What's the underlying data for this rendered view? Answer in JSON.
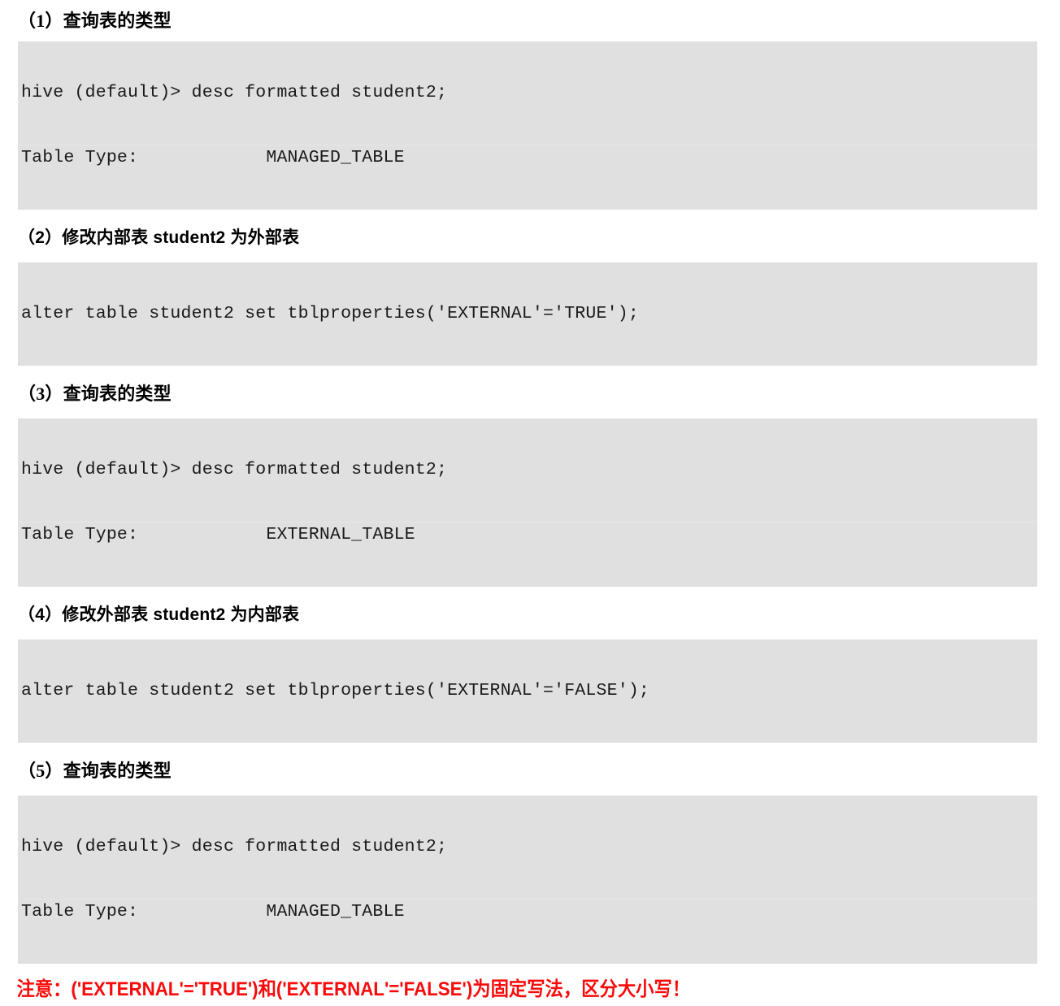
{
  "document": {
    "sections": [
      {
        "id": "s1",
        "heading": "（1）查询表的类型",
        "heading_style": "serif",
        "code_lines": [
          "hive (default)> desc formatted student2;",
          "Table Type:            MANAGED_TABLE"
        ]
      },
      {
        "id": "s2",
        "heading": "（2）修改内部表 student2 为外部表",
        "heading_style": "sans",
        "code_lines": [
          "alter table student2 set tblproperties('EXTERNAL'='TRUE');"
        ]
      },
      {
        "id": "s3",
        "heading": "（3）查询表的类型",
        "heading_style": "serif",
        "code_lines": [
          "hive (default)> desc formatted student2;",
          "Table Type:            EXTERNAL_TABLE"
        ]
      },
      {
        "id": "s4",
        "heading": "（4）修改外部表 student2 为内部表",
        "heading_style": "sans",
        "code_lines": [
          "alter table student2 set tblproperties('EXTERNAL'='FALSE');"
        ]
      },
      {
        "id": "s5",
        "heading": "（5）查询表的类型",
        "heading_style": "serif",
        "code_lines": [
          "hive (default)> desc formatted student2;",
          "Table Type:            MANAGED_TABLE"
        ]
      }
    ],
    "warning": {
      "text": "注意：('EXTERNAL'='TRUE')和('EXTERNAL'='FALSE')为固定写法，区分大小写！",
      "color": "#fa0a0a"
    },
    "colors": {
      "code_background": "#e0e0e0",
      "code_text": "#1a1a1a",
      "page_background": "#ffffff",
      "heading_text": "#000000"
    }
  }
}
